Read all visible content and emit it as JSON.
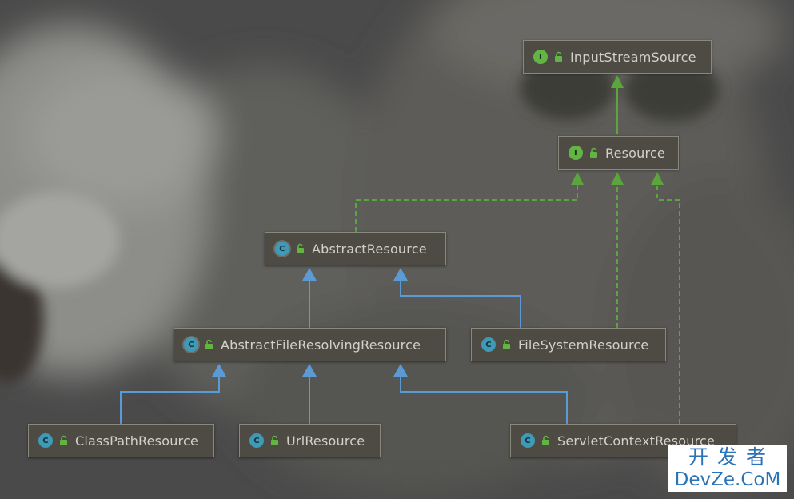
{
  "nodes": {
    "input_stream_source": {
      "label": "InputStreamSource",
      "kind": "I"
    },
    "resource": {
      "label": "Resource",
      "kind": "I"
    },
    "abstract_resource": {
      "label": "AbstractResource",
      "kind": "C"
    },
    "abstract_file_resolving_resource": {
      "label": "AbstractFileResolvingResource",
      "kind": "C"
    },
    "file_system_resource": {
      "label": "FileSystemResource",
      "kind": "C"
    },
    "class_path_resource": {
      "label": "ClassPathResource",
      "kind": "C"
    },
    "url_resource": {
      "label": "UrlResource",
      "kind": "C"
    },
    "servlet_context_resource": {
      "label": "ServletContextResource",
      "kind": "C"
    }
  },
  "edges": [
    {
      "from": "Resource",
      "to": "InputStreamSource",
      "type": "extends",
      "color": "#62b543"
    },
    {
      "from": "AbstractResource",
      "to": "Resource",
      "type": "implements",
      "color": "#62b543"
    },
    {
      "from": "FileSystemResource",
      "to": "Resource",
      "type": "implements",
      "color": "#62b543"
    },
    {
      "from": "ServletContextResource",
      "to": "Resource",
      "type": "implements",
      "color": "#62b543"
    },
    {
      "from": "AbstractFileResolvingResource",
      "to": "AbstractResource",
      "type": "extends",
      "color": "#5b9bd5"
    },
    {
      "from": "FileSystemResource",
      "to": "AbstractResource",
      "type": "extends",
      "color": "#5b9bd5"
    },
    {
      "from": "ClassPathResource",
      "to": "AbstractFileResolvingResource",
      "type": "extends",
      "color": "#5b9bd5"
    },
    {
      "from": "UrlResource",
      "to": "AbstractFileResolvingResource",
      "type": "extends",
      "color": "#5b9bd5"
    },
    {
      "from": "ServletContextResource",
      "to": "AbstractFileResolvingResource",
      "type": "extends",
      "color": "#5b9bd5"
    }
  ],
  "watermark": {
    "line1": "开发者",
    "line2": "DevZe.CoM"
  },
  "colors": {
    "interface_badge": "#62b543",
    "class_badge": "#3e9ab5",
    "implements_line": "#62b543",
    "extends_line": "#5b9bd5"
  },
  "icons": {
    "interface": "interface-icon",
    "class": "class-icon",
    "abstract_class": "abstract-class-icon",
    "visibility": "unlock-icon"
  }
}
